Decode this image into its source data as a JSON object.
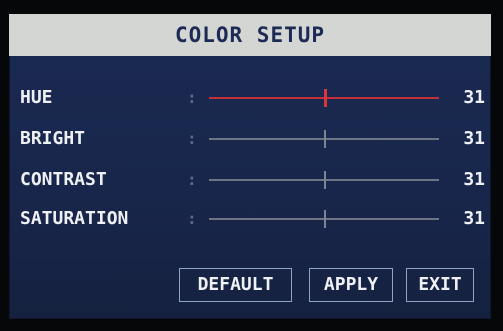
{
  "menu": {
    "title": "COLOR SETUP",
    "separator": ":",
    "active_row": "HUE",
    "accent_color": "#c2303a",
    "panel_color": "#1b2a52",
    "title_bar_color": "#d4d6d4",
    "rows": [
      {
        "label": "HUE",
        "value": "31",
        "level": 0.5
      },
      {
        "label": "BRIGHT",
        "value": "31",
        "level": 0.5
      },
      {
        "label": "CONTRAST",
        "value": "31",
        "level": 0.5
      },
      {
        "label": "SATURATION",
        "value": "31",
        "level": 0.5
      }
    ]
  },
  "buttons": {
    "default_label": "DEFAULT",
    "apply_label": "APPLY",
    "exit_label": "EXIT"
  }
}
